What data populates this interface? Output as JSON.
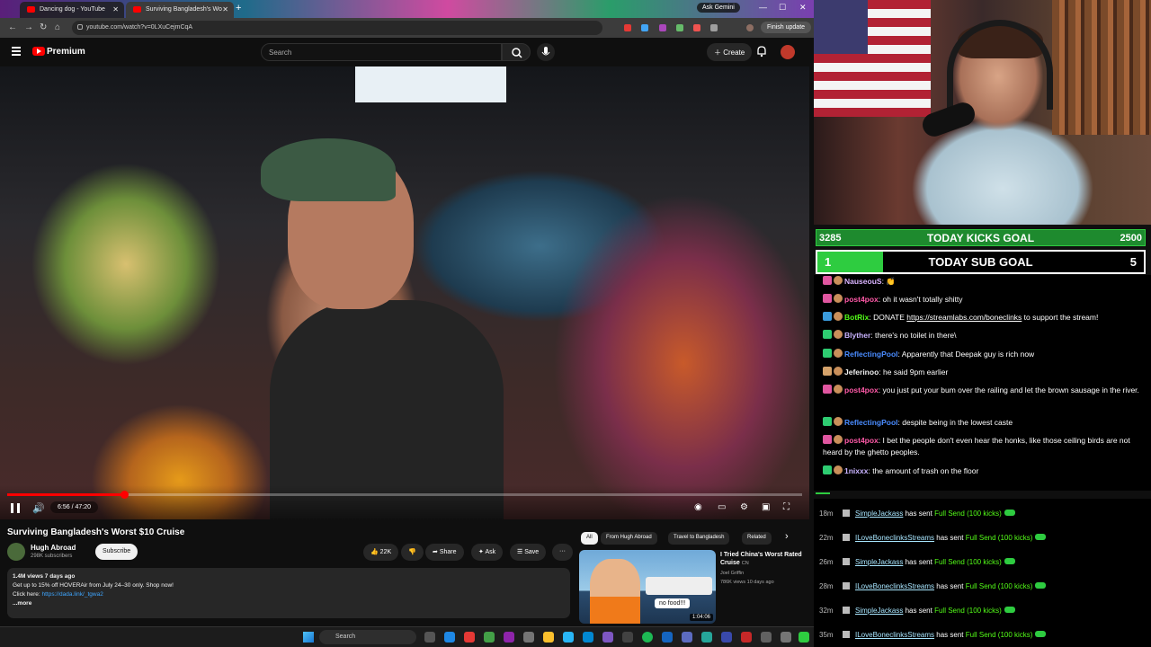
{
  "browser": {
    "tabs": [
      {
        "label": "Dancing dog - YouTube"
      },
      {
        "label": "Surviving Bangladesh's Wo"
      }
    ],
    "new_tab": "+",
    "ask_gemini": "Ask Gemini",
    "url": "youtube.com/watch?v=0LXuCejmCqA",
    "finish_update": "Finish update"
  },
  "youtube": {
    "brand": "Premium",
    "search_placeholder": "Search",
    "create_label": "Create"
  },
  "player": {
    "time": "6:56 / 47:20",
    "progress_fraction": 0.147
  },
  "video": {
    "title": "Surviving Bangladesh's Worst $10 Cruise",
    "channel": "Hugh Abroad",
    "subscribers": "298K subscribers",
    "subscribe_label": "Subscribe",
    "likes": "22K",
    "share_label": "Share",
    "ask_label": "Ask",
    "save_label": "Save",
    "more_actions": "···",
    "description": {
      "meta": "1.4M views  7 days ago",
      "line1": "Get up to 15% off HOVERAir from July 24–30 only. Shop now!",
      "line2_prefix": "Click here: ",
      "line2_link": "https://dada.link/_tgwa2",
      "more": "...more"
    }
  },
  "related": {
    "chips": [
      "All",
      "From Hugh Abroad",
      "Travel to Bangladesh",
      "Related"
    ],
    "next": "›",
    "item": {
      "title": "I Tried China's Worst Rated Cruise",
      "lang": "CN",
      "channel": "Joel Griffin",
      "stats": "786K views  10 days ago",
      "duration": "1:04:06",
      "badge": "no food!!!"
    }
  },
  "goals": {
    "kicks": {
      "current": "3285",
      "label": "TODAY KICKS GOAL",
      "target": "2500",
      "fraction": 1.0
    },
    "subs": {
      "current": "1",
      "label": "TODAY SUB GOAL",
      "target": "5",
      "fraction": 0.2
    }
  },
  "chat": {
    "messages": [
      {
        "badge": "#e056a0",
        "user": "NauseouS",
        "user_color": "#d9b3ff",
        "text": " 👏"
      },
      {
        "badge": "#e056a0",
        "user": "post4pox",
        "user_color": "#ff5aa8",
        "text": " oh it wasn't totally shitty"
      },
      {
        "badge": "#3a9bdc",
        "user": "BotRix",
        "user_color": "#53fc18",
        "text": " DONATE ",
        "link": "https://streamlabs.com/boneclinks",
        "after": " to support the stream!"
      },
      {
        "badge": "#2ecc71",
        "user": "Blyther",
        "user_color": "#c9b3ff",
        "text": " there's no toilet in there\\"
      },
      {
        "badge": "#2ecc71",
        "user": "ReflectingPool",
        "user_color": "#4a8cff",
        "text": " Apparently that Deepak guy is rich now"
      },
      {
        "badge": "#d4a26a",
        "user": "Jeferinoo",
        "user_color": "#f1f1f1",
        "text": " he said 9pm earlier"
      },
      {
        "badge": "#e056a0",
        "user": "post4pox",
        "user_color": "#ff5aa8",
        "text": " you just put your bum over the railing and let the brown sausage in the river."
      },
      {
        "badge": "#2ecc71",
        "user": "ReflectingPool",
        "user_color": "#4a8cff",
        "text": " despite being in the lowest caste"
      },
      {
        "badge": "#e056a0",
        "user": "post4pox",
        "user_color": "#ff5aa8",
        "text": " I bet the people don't even hear the honks, like those ceiling birds are not heard by the ghetto peoples."
      },
      {
        "badge": "#2ecc71",
        "user": "1nixxx",
        "user_color": "#c9b3ff",
        "text": " the amount of trash on the floor"
      }
    ]
  },
  "events": [
    {
      "age": "18m",
      "user": "SimpleJackass",
      "mid": "has sent",
      "gift": "Full Send (100 kicks)"
    },
    {
      "age": "22m",
      "user": "ILoveBoneclinksStreams",
      "mid": "has sent",
      "gift": "Full Send (100 kicks)"
    },
    {
      "age": "26m",
      "user": "SimpleJackass",
      "mid": "has sent",
      "gift": "Full Send (100 kicks)"
    },
    {
      "age": "28m",
      "user": "ILoveBoneclinksStreams",
      "mid": "has sent",
      "gift": "Full Send (100 kicks)"
    },
    {
      "age": "32m",
      "user": "SimpleJackass",
      "mid": "has sent",
      "gift": "Full Send (100 kicks)"
    },
    {
      "age": "35m",
      "user": "ILoveBoneclinksStreams",
      "mid": "has sent",
      "gift": "Full Send (100 kicks)"
    }
  ],
  "taskbar": {
    "search_placeholder": "Search"
  },
  "colors": {
    "accent_red": "#ff0000",
    "kick_green": "#53fc18",
    "goal_green": "#2ecc40"
  }
}
